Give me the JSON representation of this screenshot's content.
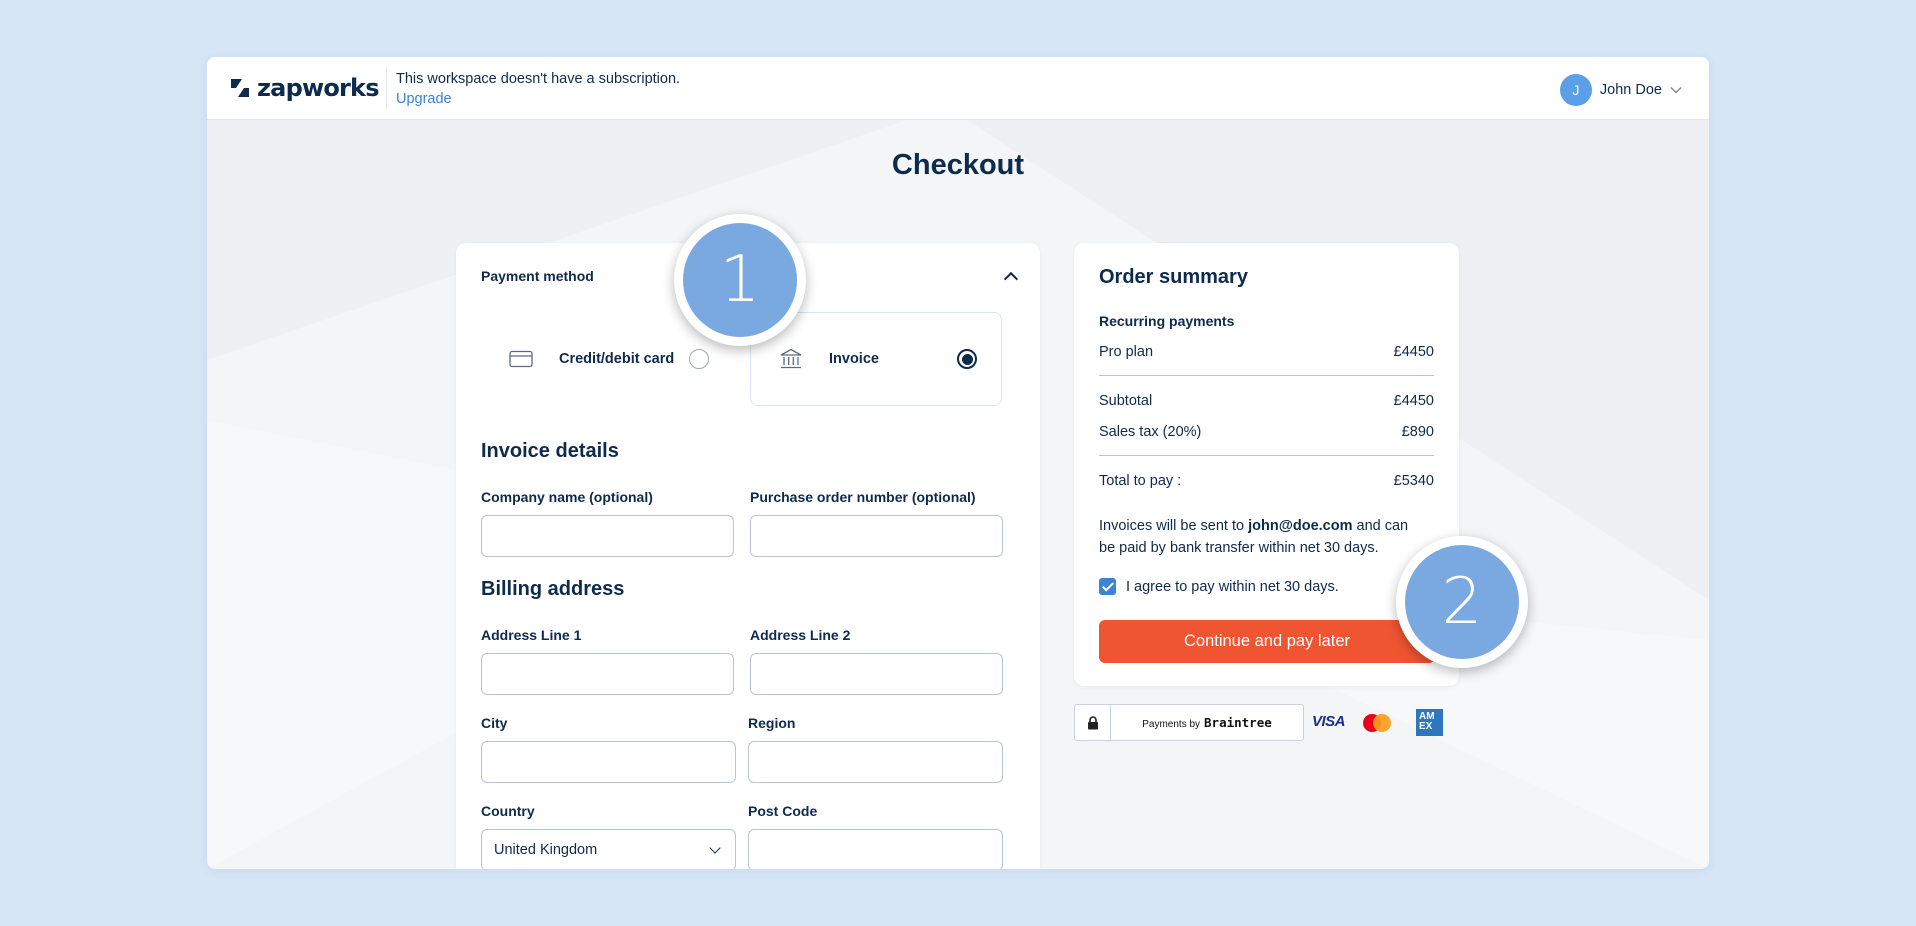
{
  "header": {
    "logo_text": "zapworks",
    "notice": "This workspace doesn't have a subscription.",
    "upgrade_link": "Upgrade",
    "user_initial": "J",
    "user_name": "John Doe"
  },
  "page_title": "Checkout",
  "payment_method": {
    "title": "Payment method",
    "options": [
      {
        "label": "Credit/debit card",
        "icon": "credit-card-icon",
        "selected": false
      },
      {
        "label": "Invoice",
        "icon": "bank-icon",
        "selected": true
      }
    ]
  },
  "invoice_details": {
    "heading": "Invoice details",
    "company_label": "Company name (optional)",
    "company_value": "",
    "po_label": "Purchase order number (optional)",
    "po_value": ""
  },
  "billing_address": {
    "heading": "Billing address",
    "address1_label": "Address Line 1",
    "address2_label": "Address Line 2",
    "city_label": "City",
    "region_label": "Region",
    "country_label": "Country",
    "country_value": "United Kingdom",
    "postcode_label": "Post Code"
  },
  "order_summary": {
    "title": "Order summary",
    "recurring_label": "Recurring payments",
    "plan_label": "Pro plan",
    "plan_price": "£4450",
    "subtotal_label": "Subtotal",
    "subtotal_value": "£4450",
    "tax_label": "Sales tax (20%)",
    "tax_value": "£890",
    "total_label": "Total to pay :",
    "total_value": "£5340",
    "note_prefix": "Invoices will be sent to ",
    "note_email": "john@doe.com",
    "note_suffix": " and can be paid by bank transfer within net 30 days.",
    "agree_label": "I agree to pay within net 30 days.",
    "agree_checked": true,
    "cta_label": "Continue and pay later"
  },
  "payment_badges": {
    "braintree_prefix": "Payments by",
    "braintree_brand": "Braintree",
    "visa": "VISA",
    "amex": "AM EX"
  },
  "annotations": {
    "step1": "1",
    "step2": "2"
  },
  "colors": {
    "background": "#d6e6f7",
    "primary_text": "#0e2a4d",
    "link": "#3c83d2",
    "cta": "#f05532",
    "badge": "#7aa9e2"
  }
}
